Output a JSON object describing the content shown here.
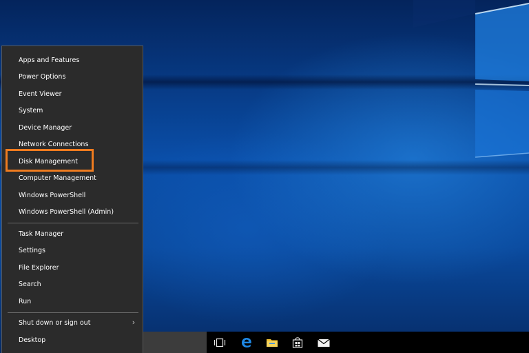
{
  "wxmenu": {
    "items": [
      {
        "label": "Apps and Features"
      },
      {
        "label": "Power Options"
      },
      {
        "label": "Event Viewer"
      },
      {
        "label": "System"
      },
      {
        "label": "Device Manager"
      },
      {
        "label": "Network Connections"
      },
      {
        "label": "Disk Management"
      },
      {
        "label": "Computer Management"
      },
      {
        "label": "Windows PowerShell"
      },
      {
        "label": "Windows PowerShell (Admin)"
      },
      {
        "label": "Task Manager"
      },
      {
        "label": "Settings"
      },
      {
        "label": "File Explorer"
      },
      {
        "label": "Search"
      },
      {
        "label": "Run"
      },
      {
        "label": "Shut down or sign out",
        "has_submenu": true
      },
      {
        "label": "Desktop"
      }
    ],
    "submenu_arrow": "›",
    "highlighted_item": "Disk Management"
  },
  "taskbar": {
    "icons": [
      {
        "name": "task-view-icon"
      },
      {
        "name": "edge-icon"
      },
      {
        "name": "file-explorer-icon"
      },
      {
        "name": "store-icon"
      },
      {
        "name": "mail-icon"
      }
    ]
  },
  "colors": {
    "menu_background": "#2b2b2b",
    "highlight_border": "#f07c1f",
    "taskbar_background": "#000000",
    "edge_blue": "#1e88e5",
    "explorer_yellow": "#f2c335",
    "desktop_blue": "#0a4ea8"
  }
}
